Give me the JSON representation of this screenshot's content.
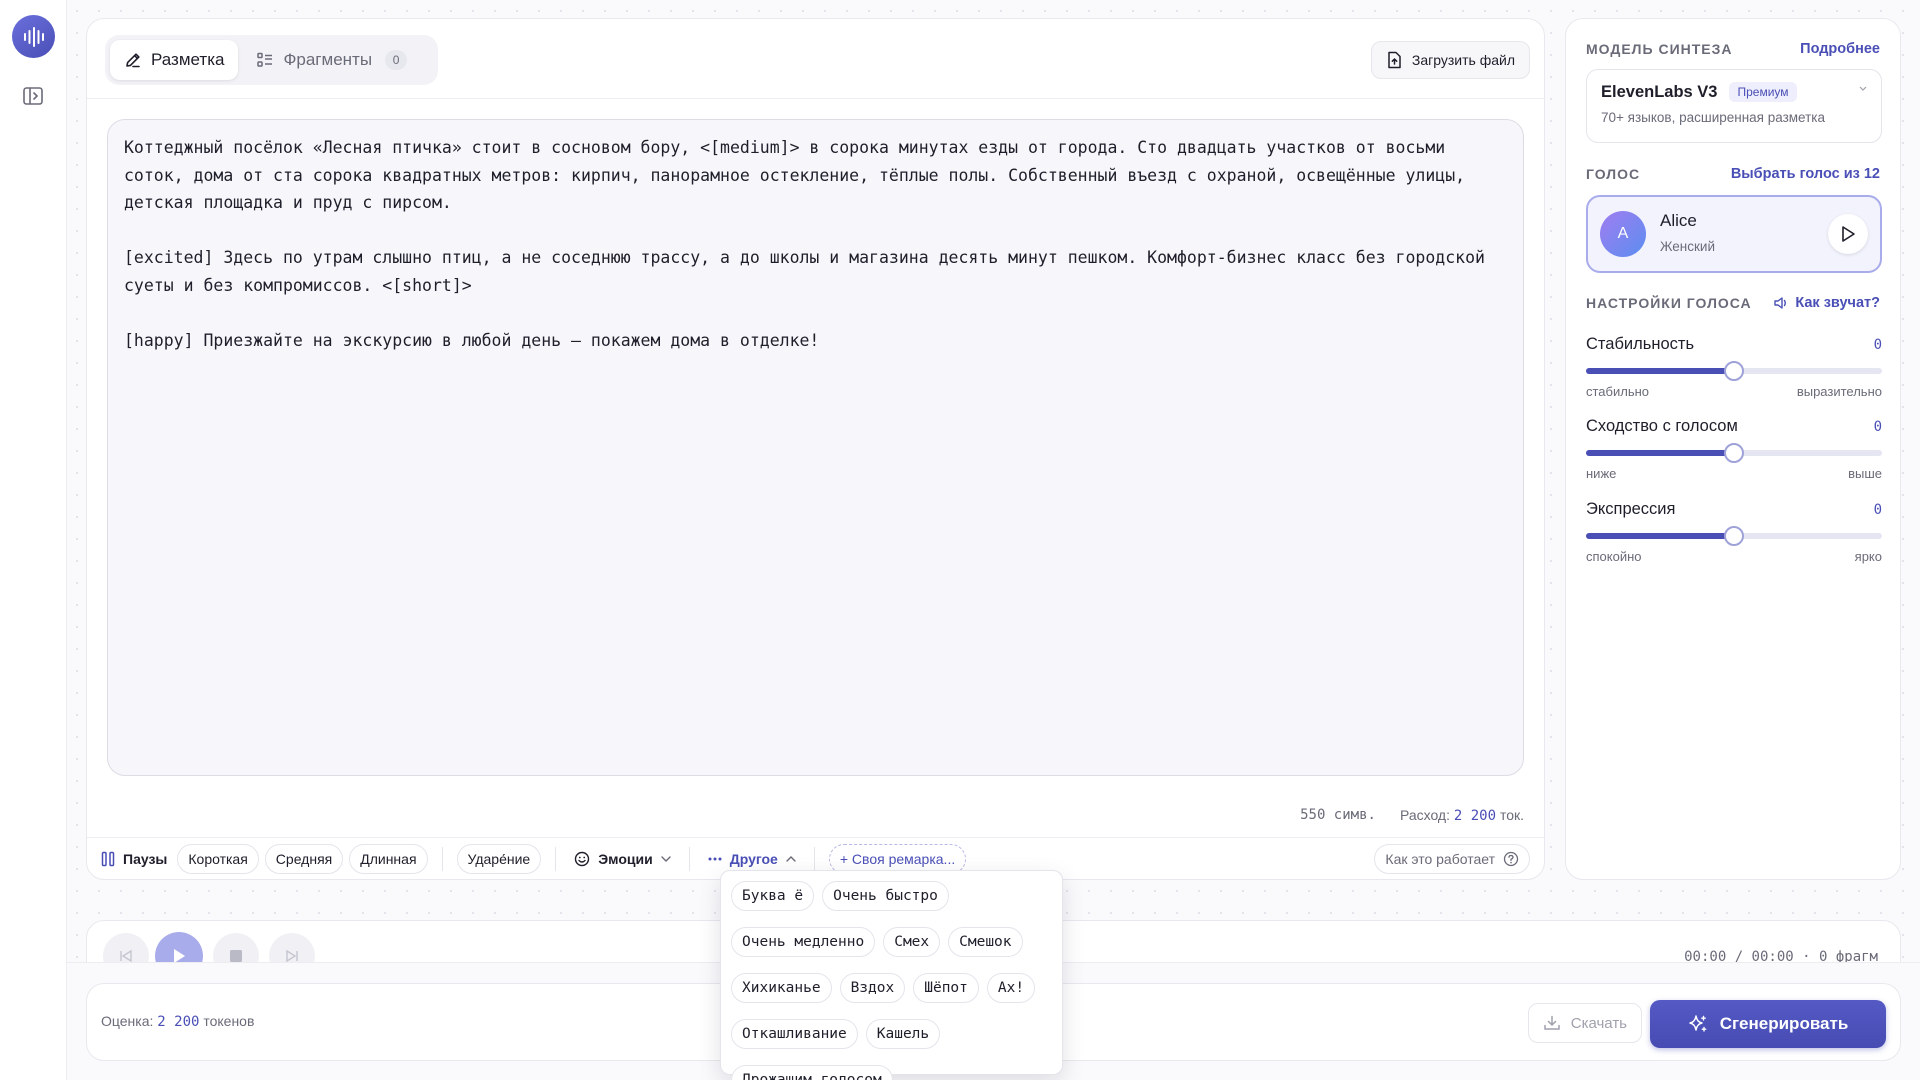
{
  "tabs": [
    {
      "label": "Разметка",
      "active": true
    },
    {
      "label": "Фрагменты",
      "count": "0",
      "active": false
    }
  ],
  "editor": {
    "upload_label": "Загрузить файл",
    "paragraphs": [
      "Коттеджный посёлок «Лесная птичка» стоит в сосновом бору, <[medium]> в сорока минутах езды от города. Сто двадцать участков от восьми соток, дома от ста сорока квадратных метров: кирпич, панорамное остекление, тёплые полы. Собственный въезд с охраной, освещённые улицы, детская площадка и пруд с пирсом.",
      "[excited] Здесь по утрам слышно птиц, а не соседнюю трассу, а до школы и магазина десять минут пешком. Комфорт-бизнес класс без городской суеты и без компромиссов. <[short]>",
      "[happy] Приезжайте на экскурсию в любой день — покажем дома в отделке!"
    ],
    "char_count": "550 симв.",
    "cost_label": "Расход:",
    "cost_value": "2 200",
    "cost_unit": "ток."
  },
  "toolbar": {
    "pauses_label": "Паузы",
    "pauses": [
      "Короткая",
      "Средняя",
      "Длинная"
    ],
    "stress_label": "Ударе́ние",
    "emotions_label": "Эмоции",
    "other_label": "Другое",
    "custom_label": "+ Своя ремарка...",
    "help_label": "Как это работает"
  },
  "other_menu": [
    [
      "Буква ё",
      "Очень быстро"
    ],
    [
      "Очень медленно",
      "Смех",
      "Смешок"
    ],
    [
      "Хихиканье",
      "Вздох",
      "Шёпот",
      "Ах!"
    ],
    [
      "Откашливание",
      "Кашель"
    ],
    [
      "Дрожащим голосом"
    ]
  ],
  "side": {
    "model_title": "Модель синтеза",
    "model_link": "Подробнее",
    "model_name": "ElevenLabs V3",
    "model_badge": "Премиум",
    "model_desc": "70+ языков, расширенная разметка",
    "voice_title": "Голос",
    "voice_link": "Выбрать голос из 12",
    "voice_avatar": "A",
    "voice_name": "Alice",
    "voice_gender": "Женский",
    "settings_title": "Настройки голоса",
    "settings_link": "Как звучат?",
    "sliders": [
      {
        "label": "Стабильность",
        "value": "0",
        "level": 0.5,
        "min_label": "стабильно",
        "max_label": "выразительно"
      },
      {
        "label": "Сходство с голосом",
        "value": "0",
        "level": 0.5,
        "min_label": "ниже",
        "max_label": "выше"
      },
      {
        "label": "Экспрессия",
        "value": "0",
        "level": 0.5,
        "min_label": "спокойно",
        "max_label": "ярко"
      }
    ]
  },
  "player": {
    "time": "00:00 / 00:00 · 0 фрагм"
  },
  "bottom": {
    "estimate_label": "Оценка:",
    "estimate_value": "2 200",
    "estimate_unit": "токенов",
    "download_label": "Скачать",
    "generate_label": "Сгенерировать"
  },
  "colors": {
    "accent": "#4a4fb6",
    "muted": "#6a6b78"
  }
}
